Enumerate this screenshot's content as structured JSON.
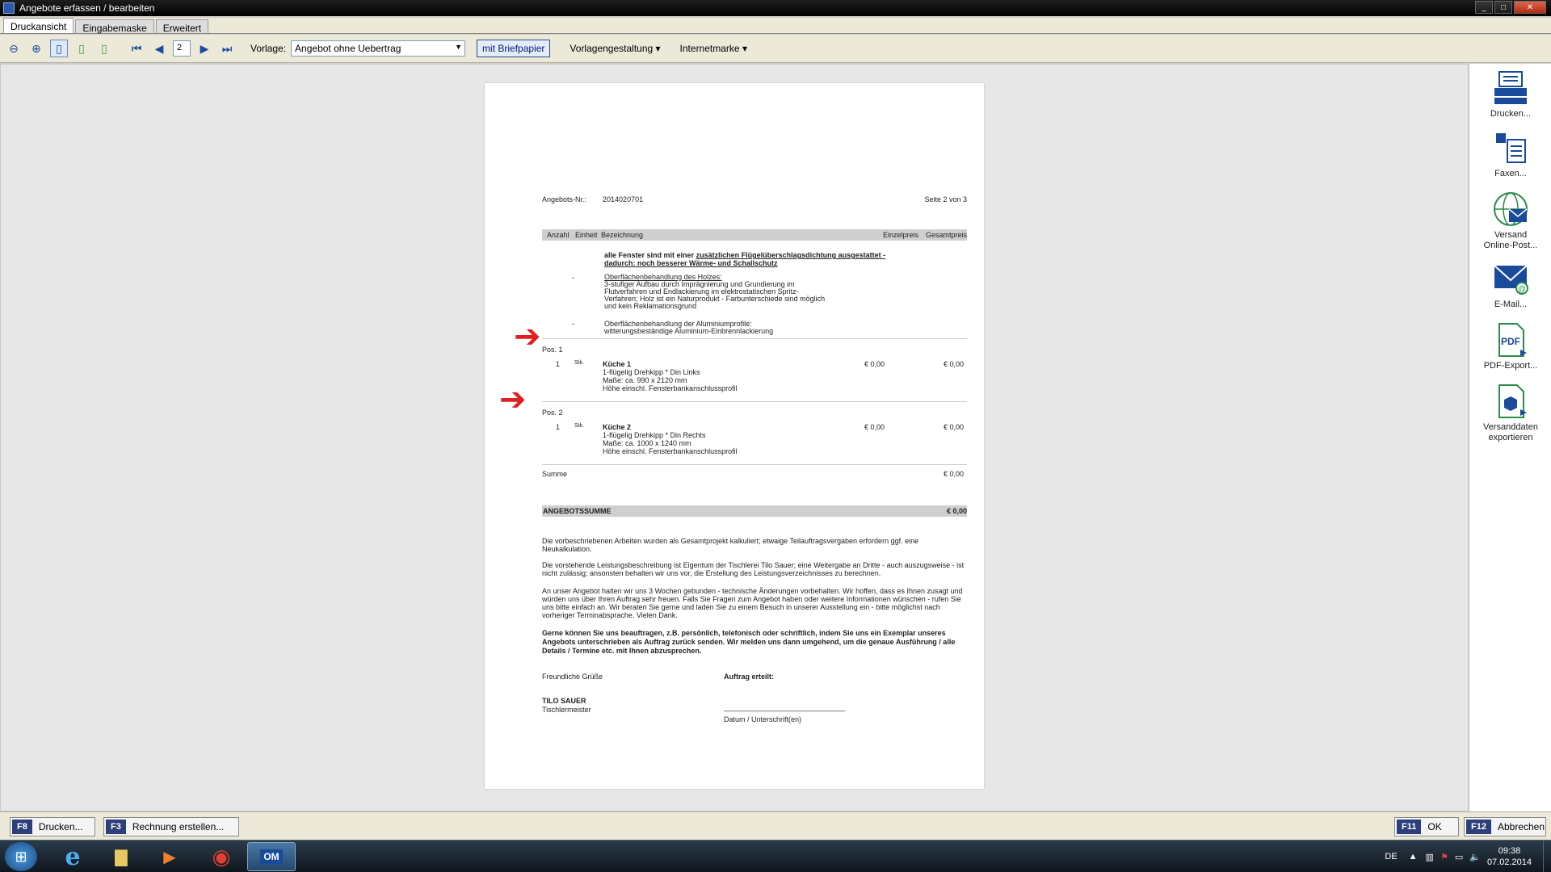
{
  "window": {
    "title": "Angebote erfassen / bearbeiten"
  },
  "tabs": [
    {
      "label": "Druckansicht"
    },
    {
      "label": "Eingabemaske"
    },
    {
      "label": "Erweitert"
    }
  ],
  "toolbar": {
    "page_value": "2",
    "vorlage_label": "Vorlage:",
    "vorlage_value": "Angebot ohne Uebertrag",
    "briefpapier_label": "mit Briefpapier",
    "vorlagengestaltung_label": "Vorlagengestaltung",
    "internetmarke_label": "Internetmarke"
  },
  "document": {
    "angebots_nr_label": "Angebots-Nr.:",
    "angebots_nr": "2014020701",
    "seite": "Seite 2 von 3",
    "columns": {
      "anzahl": "Anzahl",
      "einheit": "Einheit",
      "bezeichnung": "Bezeichnung",
      "einzelpreis": "Einzelpreis",
      "gesamtpreis": "Gesamtpreis"
    },
    "intro_a": "alle Fenster sind mit einer",
    "intro_b": "zusätzlichen Flügelüberschlagsdichtung ausgestattet -",
    "intro_c": "dadurch: noch besserer Wärme- und Schallschutz",
    "dash": "-",
    "holz_title": "Oberflächenbehandlung des Holzes:",
    "holz_l1": "3-stufiger Aufbau durch Imprägnierung und Grundierung im",
    "holz_l2": "Flutverfahren und Endlackierung im elektrostatischen Spritz-",
    "holz_l3": "Verfahren; Holz ist ein Naturprodukt - Farbunterschiede sind möglich",
    "holz_l4": "und kein Reklamationsgrund",
    "alu_l1": "Oberflächenbehandlung der Aluminiumprofile:",
    "alu_l2": "witterungsbeständige Aluminium-Einbrennlackierung",
    "positions": [
      {
        "pos": "Pos. 1",
        "anzahl": "1",
        "einheit": "Stk.",
        "title": "Küche 1",
        "l1": "1-flügelig Drehkipp * Din Links",
        "l2": "Maße: ca. 990 x 2120 mm",
        "l3": "Höhe einschl. Fensterbankanschlussprofil",
        "einzel": "€ 0,00",
        "gesamt": "€ 0,00"
      },
      {
        "pos": "Pos. 2",
        "anzahl": "1",
        "einheit": "Stk.",
        "title": "Küche 2",
        "l1": "1-flügelig Drehkipp * Din Rechts",
        "l2": "Maße: ca. 1000 x 1240 mm",
        "l3": "Höhe einschl. Fensterbankanschlussprofil",
        "einzel": "€ 0,00",
        "gesamt": "€ 0,00"
      }
    ],
    "summe_label": "Summe",
    "summe_value": "€ 0,00",
    "angebotssumme_label": "ANGEBOTSSUMME",
    "angebotssumme_value": "€ 0,00",
    "p1": "Die vorbeschriebenen Arbeiten wurden als Gesamtprojekt kalkuliert; etwaige Teilauftragsvergaben erfordern ggf. eine Neukalkulation.",
    "p2": "Die vorstehende Leistungsbeschreibung ist Eigentum der Tischlerei Tilo Sauer; eine Weitergabe an Dritte - auch auszugsweise - ist nicht zulässig; ansonsten behalten wir uns vor, die Erstellung des Leistungsverzeichnisses zu berechnen.",
    "p3": "An unser Angebot halten wir uns 3 Wochen gebunden - technische Änderungen vorbehalten. Wir hoffen, dass es Ihnen zusagt und würden uns über Ihren Auftrag sehr freuen. Falls Sie Fragen zum Angebot haben oder weitere Informationen wünschen - rufen Sie uns bitte einfach an. Wir beraten Sie gerne und laden Sie zu einem Besuch in unserer Ausstellung ein - bitte möglichst nach vorheriger Terminabsprache. Vielen Dank.",
    "p4": "Gerne können Sie uns beauftragen, z.B. persönlich, telefonisch oder schriftlich, indem Sie uns ein Exemplar unseres Angebots unterschrieben als Auftrag zurück senden. Wir melden uns dann umgehend, um die genaue Ausführung / alle Details / Termine etc. mit Ihnen abzusprechen.",
    "gruesse": "Freundliche Grüße",
    "auftrag": "Auftrag erteilt:",
    "name": "TILO SAUER",
    "beruf": "Tischlermeister",
    "line": "______________________________",
    "datum": "Datum / Unterschrift(en)"
  },
  "right_panel": [
    {
      "label": "Drucken..."
    },
    {
      "label": "Faxen..."
    },
    {
      "label": "Versand Online-Post..."
    },
    {
      "label": "E-Mail..."
    },
    {
      "label": "PDF-Export..."
    },
    {
      "label": "Versanddaten exportieren"
    }
  ],
  "bottom": {
    "f8_key": "F8",
    "f8_label": "Drucken...",
    "f3_key": "F3",
    "f3_label": "Rechnung erstellen...",
    "f11_key": "F11",
    "f11_label": "OK",
    "f12_key": "F12",
    "f12_label": "Abbrechen"
  },
  "taskbar": {
    "lang": "DE",
    "time": "09:38",
    "date": "07.02.2014"
  }
}
